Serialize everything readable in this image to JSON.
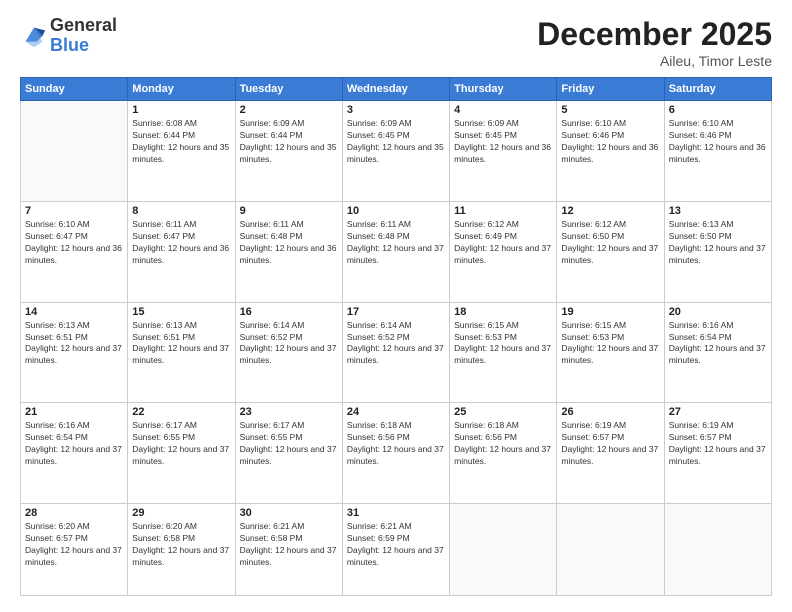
{
  "header": {
    "logo": {
      "general": "General",
      "blue": "Blue"
    },
    "title": "December 2025",
    "location": "Aileu, Timor Leste"
  },
  "days_of_week": [
    "Sunday",
    "Monday",
    "Tuesday",
    "Wednesday",
    "Thursday",
    "Friday",
    "Saturday"
  ],
  "weeks": [
    [
      {
        "day": "",
        "sunrise": "",
        "sunset": "",
        "daylight": ""
      },
      {
        "day": "1",
        "sunrise": "6:08 AM",
        "sunset": "6:44 PM",
        "daylight": "12 hours and 35 minutes."
      },
      {
        "day": "2",
        "sunrise": "6:09 AM",
        "sunset": "6:44 PM",
        "daylight": "12 hours and 35 minutes."
      },
      {
        "day": "3",
        "sunrise": "6:09 AM",
        "sunset": "6:45 PM",
        "daylight": "12 hours and 35 minutes."
      },
      {
        "day": "4",
        "sunrise": "6:09 AM",
        "sunset": "6:45 PM",
        "daylight": "12 hours and 36 minutes."
      },
      {
        "day": "5",
        "sunrise": "6:10 AM",
        "sunset": "6:46 PM",
        "daylight": "12 hours and 36 minutes."
      },
      {
        "day": "6",
        "sunrise": "6:10 AM",
        "sunset": "6:46 PM",
        "daylight": "12 hours and 36 minutes."
      }
    ],
    [
      {
        "day": "7",
        "sunrise": "6:10 AM",
        "sunset": "6:47 PM",
        "daylight": "12 hours and 36 minutes."
      },
      {
        "day": "8",
        "sunrise": "6:11 AM",
        "sunset": "6:47 PM",
        "daylight": "12 hours and 36 minutes."
      },
      {
        "day": "9",
        "sunrise": "6:11 AM",
        "sunset": "6:48 PM",
        "daylight": "12 hours and 36 minutes."
      },
      {
        "day": "10",
        "sunrise": "6:11 AM",
        "sunset": "6:48 PM",
        "daylight": "12 hours and 37 minutes."
      },
      {
        "day": "11",
        "sunrise": "6:12 AM",
        "sunset": "6:49 PM",
        "daylight": "12 hours and 37 minutes."
      },
      {
        "day": "12",
        "sunrise": "6:12 AM",
        "sunset": "6:50 PM",
        "daylight": "12 hours and 37 minutes."
      },
      {
        "day": "13",
        "sunrise": "6:13 AM",
        "sunset": "6:50 PM",
        "daylight": "12 hours and 37 minutes."
      }
    ],
    [
      {
        "day": "14",
        "sunrise": "6:13 AM",
        "sunset": "6:51 PM",
        "daylight": "12 hours and 37 minutes."
      },
      {
        "day": "15",
        "sunrise": "6:13 AM",
        "sunset": "6:51 PM",
        "daylight": "12 hours and 37 minutes."
      },
      {
        "day": "16",
        "sunrise": "6:14 AM",
        "sunset": "6:52 PM",
        "daylight": "12 hours and 37 minutes."
      },
      {
        "day": "17",
        "sunrise": "6:14 AM",
        "sunset": "6:52 PM",
        "daylight": "12 hours and 37 minutes."
      },
      {
        "day": "18",
        "sunrise": "6:15 AM",
        "sunset": "6:53 PM",
        "daylight": "12 hours and 37 minutes."
      },
      {
        "day": "19",
        "sunrise": "6:15 AM",
        "sunset": "6:53 PM",
        "daylight": "12 hours and 37 minutes."
      },
      {
        "day": "20",
        "sunrise": "6:16 AM",
        "sunset": "6:54 PM",
        "daylight": "12 hours and 37 minutes."
      }
    ],
    [
      {
        "day": "21",
        "sunrise": "6:16 AM",
        "sunset": "6:54 PM",
        "daylight": "12 hours and 37 minutes."
      },
      {
        "day": "22",
        "sunrise": "6:17 AM",
        "sunset": "6:55 PM",
        "daylight": "12 hours and 37 minutes."
      },
      {
        "day": "23",
        "sunrise": "6:17 AM",
        "sunset": "6:55 PM",
        "daylight": "12 hours and 37 minutes."
      },
      {
        "day": "24",
        "sunrise": "6:18 AM",
        "sunset": "6:56 PM",
        "daylight": "12 hours and 37 minutes."
      },
      {
        "day": "25",
        "sunrise": "6:18 AM",
        "sunset": "6:56 PM",
        "daylight": "12 hours and 37 minutes."
      },
      {
        "day": "26",
        "sunrise": "6:19 AM",
        "sunset": "6:57 PM",
        "daylight": "12 hours and 37 minutes."
      },
      {
        "day": "27",
        "sunrise": "6:19 AM",
        "sunset": "6:57 PM",
        "daylight": "12 hours and 37 minutes."
      }
    ],
    [
      {
        "day": "28",
        "sunrise": "6:20 AM",
        "sunset": "6:57 PM",
        "daylight": "12 hours and 37 minutes."
      },
      {
        "day": "29",
        "sunrise": "6:20 AM",
        "sunset": "6:58 PM",
        "daylight": "12 hours and 37 minutes."
      },
      {
        "day": "30",
        "sunrise": "6:21 AM",
        "sunset": "6:58 PM",
        "daylight": "12 hours and 37 minutes."
      },
      {
        "day": "31",
        "sunrise": "6:21 AM",
        "sunset": "6:59 PM",
        "daylight": "12 hours and 37 minutes."
      },
      {
        "day": "",
        "sunrise": "",
        "sunset": "",
        "daylight": ""
      },
      {
        "day": "",
        "sunrise": "",
        "sunset": "",
        "daylight": ""
      },
      {
        "day": "",
        "sunrise": "",
        "sunset": "",
        "daylight": ""
      }
    ]
  ]
}
